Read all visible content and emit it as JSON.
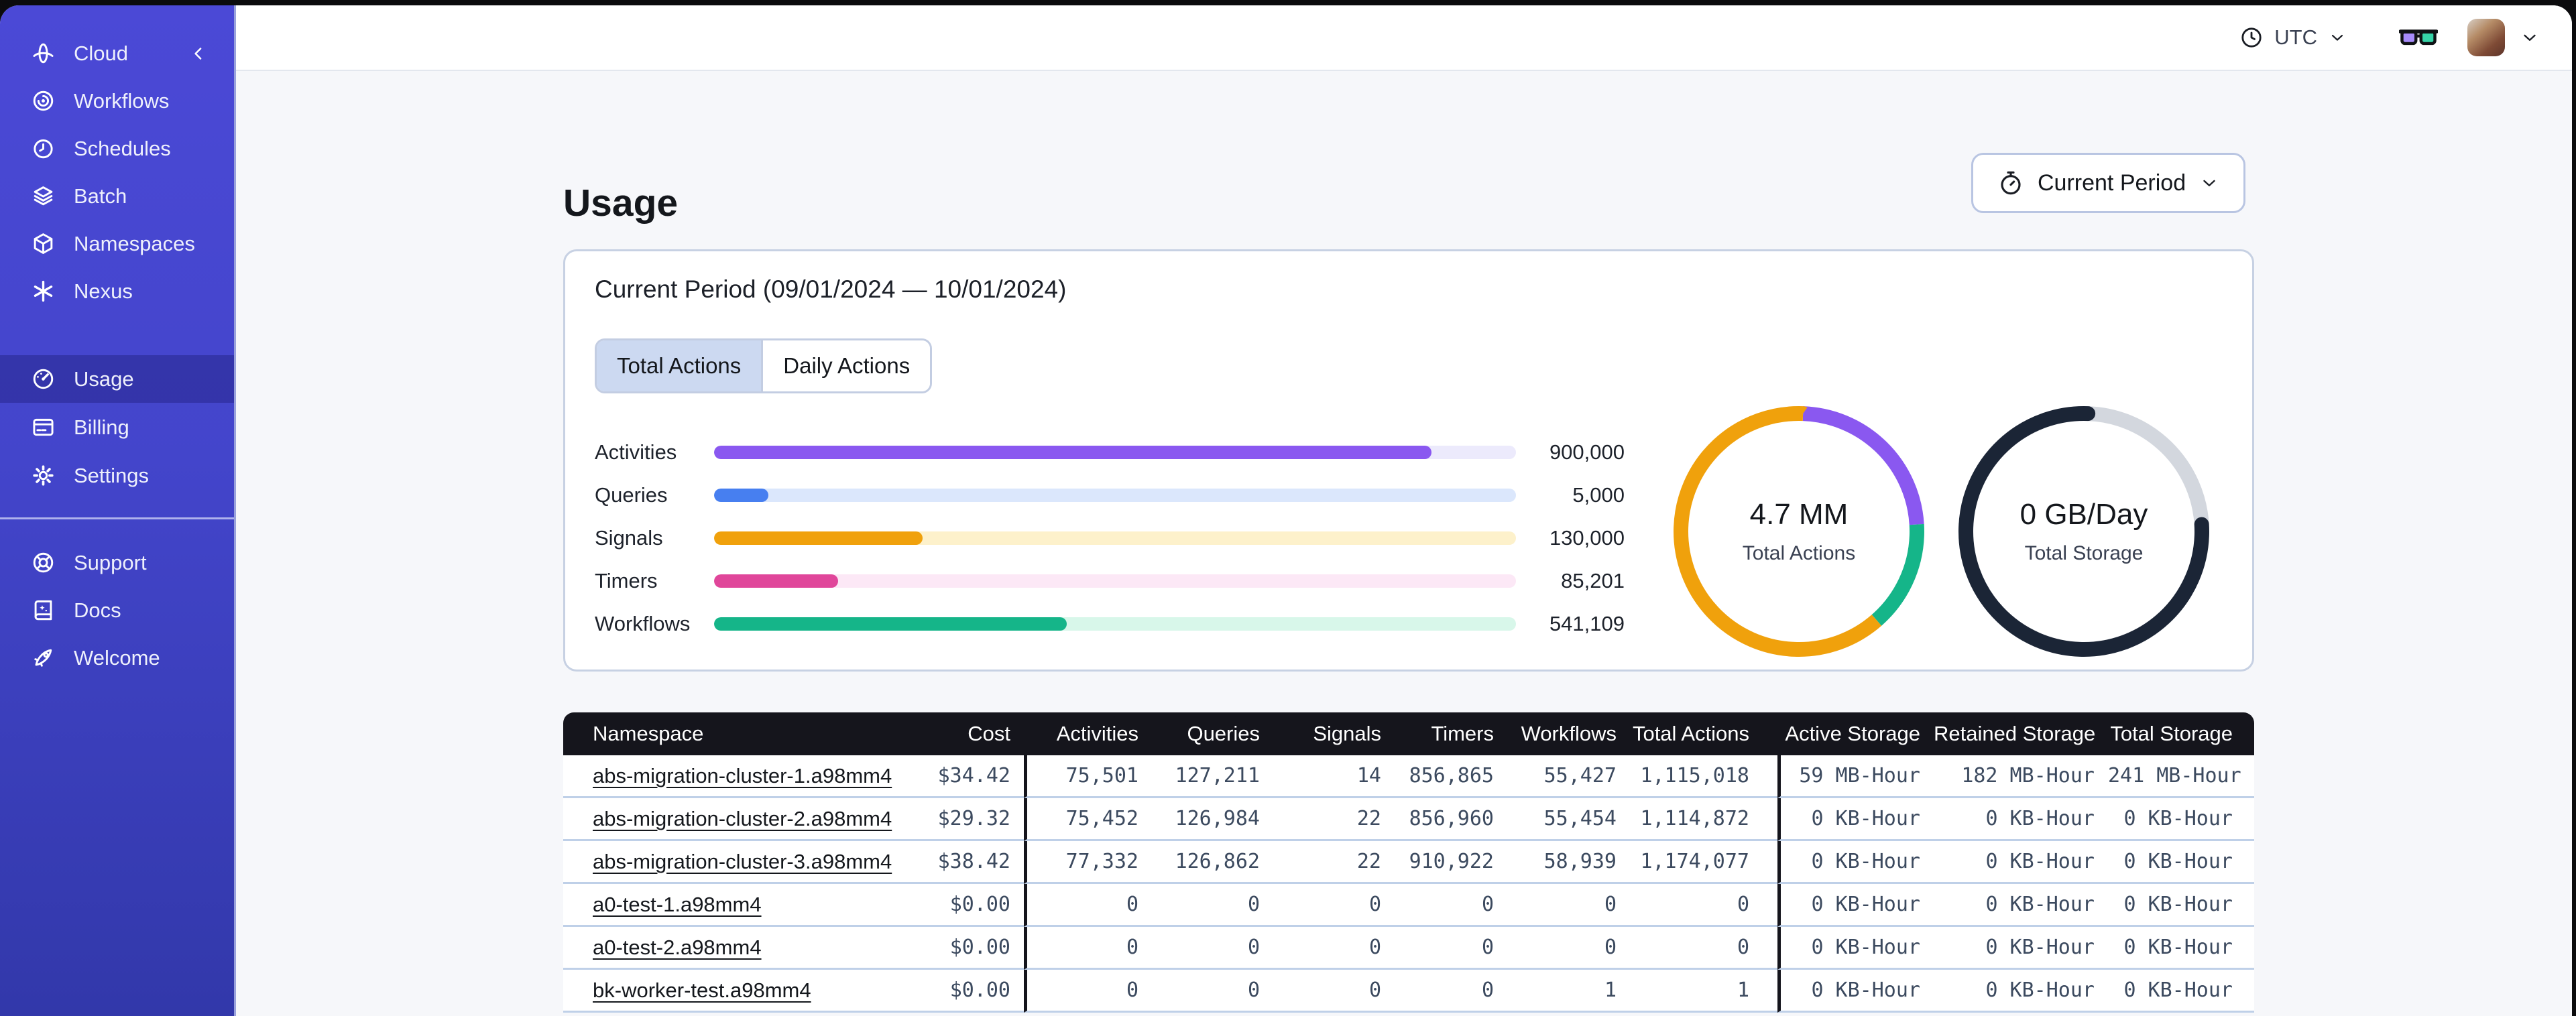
{
  "topbar": {
    "timezone_label": "UTC"
  },
  "sidebar": {
    "brand_label": "Cloud",
    "nav_main": [
      {
        "label": "Workflows",
        "icon": "workflows-icon"
      },
      {
        "label": "Schedules",
        "icon": "schedules-icon"
      },
      {
        "label": "Batch",
        "icon": "batch-icon"
      },
      {
        "label": "Namespaces",
        "icon": "namespaces-icon"
      },
      {
        "label": "Nexus",
        "icon": "nexus-icon"
      }
    ],
    "nav_account": [
      {
        "label": "Usage",
        "icon": "usage-gauge-icon",
        "active": true
      },
      {
        "label": "Billing",
        "icon": "billing-icon",
        "active": false
      },
      {
        "label": "Settings",
        "icon": "settings-gear-icon",
        "active": false
      }
    ],
    "nav_footer": [
      {
        "label": "Support",
        "icon": "support-lifebuoy-icon"
      },
      {
        "label": "Docs",
        "icon": "docs-book-icon"
      },
      {
        "label": "Welcome",
        "icon": "welcome-rocket-icon"
      }
    ]
  },
  "page": {
    "title": "Usage",
    "period_selector_label": "Current Period"
  },
  "usage_card": {
    "title": "Current Period (09/01/2024 — 10/01/2024)",
    "tabs": [
      {
        "label": "Total Actions",
        "active": true
      },
      {
        "label": "Daily Actions",
        "active": false
      }
    ],
    "bars": [
      {
        "label": "Activities",
        "value": "900,000",
        "fill_pct": 89.5,
        "color": "#8a58f0",
        "track": "#eceafc"
      },
      {
        "label": "Queries",
        "value": "5,000",
        "fill_pct": 6.8,
        "color": "#477ff0",
        "track": "#dbe7fc"
      },
      {
        "label": "Signals",
        "value": "130,000",
        "fill_pct": 26,
        "color": "#f0a10c",
        "track": "#fdf1cb"
      },
      {
        "label": "Timers",
        "value": "85,201",
        "fill_pct": 15.5,
        "color": "#e0469a",
        "track": "#fce8f6"
      },
      {
        "label": "Workflows",
        "value": "541,109",
        "fill_pct": 44,
        "color": "#15b589",
        "track": "#d8f7ea"
      }
    ],
    "donuts": [
      {
        "value": "4.7 MM",
        "caption": "Total Actions",
        "segments": [
          {
            "color": "#8a58f0",
            "pct": 23.5
          },
          {
            "color": "#15b589",
            "pct": 14.5
          },
          {
            "color": "#f0a10c",
            "pct": 62
          }
        ]
      },
      {
        "value": "0 GB/Day",
        "caption": "Total Storage",
        "segments": [
          {
            "color": "#d3d7de",
            "pct": 23.5
          },
          {
            "color": "#1b2536",
            "pct": 76.5,
            "cap": "round"
          }
        ]
      }
    ]
  },
  "table": {
    "columns": [
      "Namespace",
      "Cost",
      "Activities",
      "Queries",
      "Signals",
      "Timers",
      "Workflows",
      "Total Actions",
      "Active Storage",
      "Retained Storage",
      "Total Storage"
    ],
    "rows": [
      [
        "abs-migration-cluster-1.a98mm4",
        "$34.42",
        "75,501",
        "127,211",
        "14",
        "856,865",
        "55,427",
        "1,115,018",
        "59 MB-Hour",
        "182 MB-Hour",
        "241 MB-Hour"
      ],
      [
        "abs-migration-cluster-2.a98mm4",
        "$29.32",
        "75,452",
        "126,984",
        "22",
        "856,960",
        "55,454",
        "1,114,872",
        "0 KB-Hour",
        "0 KB-Hour",
        "0 KB-Hour"
      ],
      [
        "abs-migration-cluster-3.a98mm4",
        "$38.42",
        "77,332",
        "126,862",
        "22",
        "910,922",
        "58,939",
        "1,174,077",
        "0 KB-Hour",
        "0 KB-Hour",
        "0 KB-Hour"
      ],
      [
        "a0-test-1.a98mm4",
        "$0.00",
        "0",
        "0",
        "0",
        "0",
        "0",
        "0",
        "0 KB-Hour",
        "0 KB-Hour",
        "0 KB-Hour"
      ],
      [
        "a0-test-2.a98mm4",
        "$0.00",
        "0",
        "0",
        "0",
        "0",
        "0",
        "0",
        "0 KB-Hour",
        "0 KB-Hour",
        "0 KB-Hour"
      ],
      [
        "bk-worker-test.a98mm4",
        "$0.00",
        "0",
        "0",
        "0",
        "0",
        "1",
        "1",
        "0 KB-Hour",
        "0 KB-Hour",
        "0 KB-Hour"
      ]
    ]
  }
}
